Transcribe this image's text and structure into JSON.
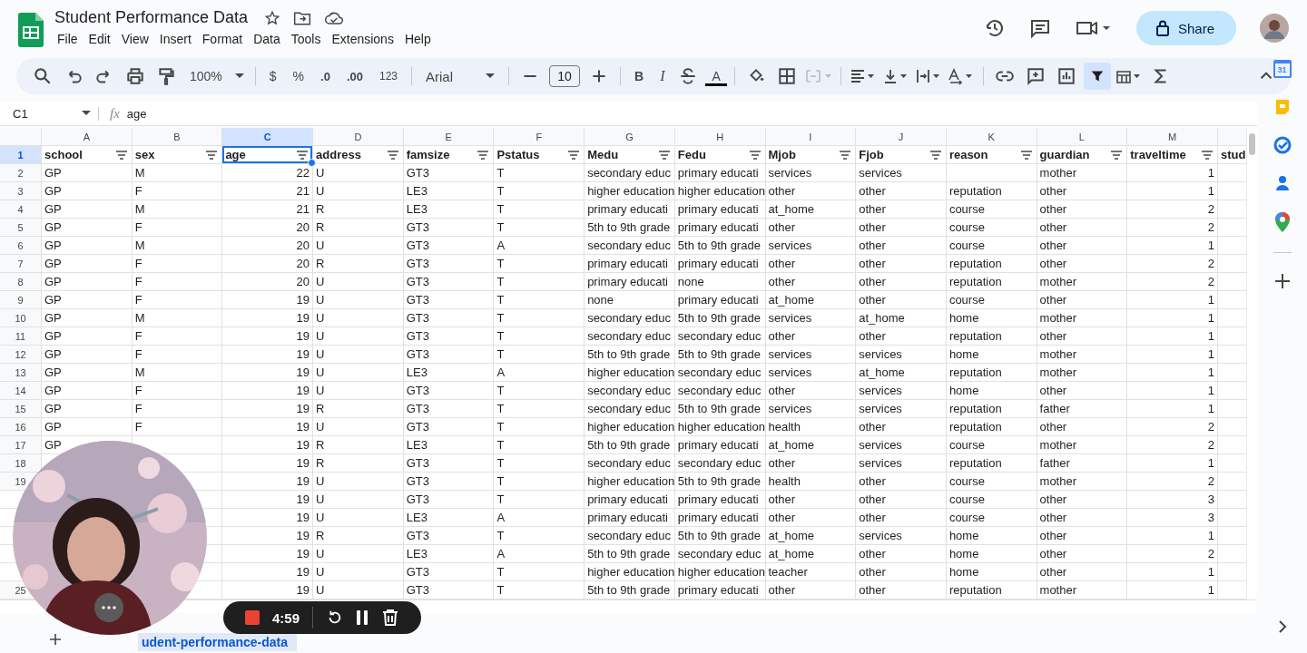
{
  "app": {
    "title": "Student Performance Data",
    "menu": [
      "File",
      "Edit",
      "View",
      "Insert",
      "Format",
      "Data",
      "Tools",
      "Extensions",
      "Help"
    ],
    "share": "Share"
  },
  "toolbar": {
    "zoom": "100%",
    "currency": "$",
    "percent": "%",
    "decrease_decimals": ".0",
    "increase_decimals": ".00",
    "number_format": "123",
    "font": "Arial",
    "font_size": "10",
    "bold": "B",
    "italic": "I",
    "text_color": "A",
    "filter_on": true
  },
  "formula_bar": {
    "cell_ref": "C1",
    "fx": "fx",
    "value": "age"
  },
  "side_panel": {
    "calendar_day": "31"
  },
  "sheet": {
    "columns": [
      {
        "letter": "A",
        "header": "school",
        "numeric": false,
        "selected": false,
        "filter": true
      },
      {
        "letter": "B",
        "header": "sex",
        "numeric": false,
        "selected": false,
        "filter": true
      },
      {
        "letter": "C",
        "header": "age",
        "numeric": true,
        "selected": true,
        "filter": true
      },
      {
        "letter": "D",
        "header": "address",
        "numeric": false,
        "selected": false,
        "filter": true
      },
      {
        "letter": "E",
        "header": "famsize",
        "numeric": false,
        "selected": false,
        "filter": true
      },
      {
        "letter": "F",
        "header": "Pstatus",
        "numeric": false,
        "selected": false,
        "filter": true
      },
      {
        "letter": "G",
        "header": "Medu",
        "numeric": false,
        "selected": false,
        "filter": true
      },
      {
        "letter": "H",
        "header": "Fedu",
        "numeric": false,
        "selected": false,
        "filter": true
      },
      {
        "letter": "I",
        "header": "Mjob",
        "numeric": false,
        "selected": false,
        "filter": true
      },
      {
        "letter": "J",
        "header": "Fjob",
        "numeric": false,
        "selected": false,
        "filter": true
      },
      {
        "letter": "K",
        "header": "reason",
        "numeric": false,
        "selected": false,
        "filter": true
      },
      {
        "letter": "L",
        "header": "guardian",
        "numeric": false,
        "selected": false,
        "filter": true
      },
      {
        "letter": "M",
        "header": "traveltime",
        "numeric": true,
        "selected": false,
        "filter": true
      },
      {
        "header": "stud",
        "selected": false,
        "filter": false
      }
    ],
    "header_row": {
      "number": "1",
      "selected": true
    },
    "rows": [
      {
        "number": "2",
        "selected": false,
        "cells": [
          "GP",
          "M",
          "22",
          "U",
          "GT3",
          "T",
          "secondary educ",
          "primary educati",
          "services",
          "services",
          null,
          "mother",
          "1",
          null
        ]
      },
      {
        "number": "3",
        "selected": false,
        "cells": [
          "GP",
          "F",
          "21",
          "U",
          "LE3",
          "T",
          "higher education",
          "higher education",
          "other",
          "other",
          "reputation",
          "other",
          "1",
          null
        ]
      },
      {
        "number": "4",
        "selected": false,
        "cells": [
          "GP",
          "M",
          "21",
          "R",
          "LE3",
          "T",
          "primary educati",
          "primary educati",
          "at_home",
          "other",
          "course",
          "other",
          "2",
          null
        ]
      },
      {
        "number": "5",
        "selected": false,
        "cells": [
          "GP",
          "F",
          "20",
          "R",
          "GT3",
          "T",
          "5th to 9th grade",
          "primary educati",
          "other",
          "other",
          "course",
          "other",
          "2",
          null
        ]
      },
      {
        "number": "6",
        "selected": false,
        "cells": [
          "GP",
          "M",
          "20",
          "U",
          "GT3",
          "A",
          "secondary educ",
          "5th to 9th grade",
          "services",
          "other",
          "course",
          "other",
          "1",
          null
        ]
      },
      {
        "number": "7",
        "selected": false,
        "cells": [
          "GP",
          "F",
          "20",
          "R",
          "GT3",
          "T",
          "primary educati",
          "primary educati",
          "other",
          "other",
          "reputation",
          "other",
          "2",
          null
        ]
      },
      {
        "number": "8",
        "selected": false,
        "cells": [
          "GP",
          "F",
          "20",
          "U",
          "GT3",
          "T",
          "primary educati",
          "none",
          "other",
          "other",
          "reputation",
          "mother",
          "2",
          null
        ]
      },
      {
        "number": "9",
        "selected": false,
        "cells": [
          "GP",
          "F",
          "19",
          "U",
          "GT3",
          "T",
          "none",
          "primary educati",
          "at_home",
          "other",
          "course",
          "other",
          "1",
          null
        ]
      },
      {
        "number": "10",
        "selected": false,
        "cells": [
          "GP",
          "M",
          "19",
          "U",
          "GT3",
          "T",
          "secondary educ",
          "5th to 9th grade",
          "services",
          "at_home",
          "home",
          "mother",
          "1",
          null
        ]
      },
      {
        "number": "11",
        "selected": false,
        "cells": [
          "GP",
          "F",
          "19",
          "U",
          "GT3",
          "T",
          "secondary educ",
          "secondary educ",
          "other",
          "other",
          "reputation",
          "other",
          "1",
          null
        ]
      },
      {
        "number": "12",
        "selected": false,
        "cells": [
          "GP",
          "F",
          "19",
          "U",
          "GT3",
          "T",
          "5th to 9th grade",
          "5th to 9th grade",
          "services",
          "services",
          "home",
          "mother",
          "1",
          null
        ]
      },
      {
        "number": "13",
        "selected": false,
        "cells": [
          "GP",
          "M",
          "19",
          "U",
          "LE3",
          "A",
          "higher education",
          "secondary educ",
          "services",
          "at_home",
          "reputation",
          "mother",
          "1",
          null
        ]
      },
      {
        "number": "14",
        "selected": false,
        "cells": [
          "GP",
          "F",
          "19",
          "U",
          "GT3",
          "T",
          "secondary educ",
          "secondary educ",
          "other",
          "services",
          "home",
          "other",
          "1",
          null
        ]
      },
      {
        "number": "15",
        "selected": false,
        "cells": [
          "GP",
          "F",
          "19",
          "R",
          "GT3",
          "T",
          "secondary educ",
          "5th to 9th grade",
          "services",
          "services",
          "reputation",
          "father",
          "1",
          null
        ]
      },
      {
        "number": "16",
        "selected": false,
        "cells": [
          "GP",
          "F",
          "19",
          "U",
          "GT3",
          "T",
          "higher education",
          "higher education",
          "health",
          "other",
          "reputation",
          "other",
          "2",
          null
        ]
      },
      {
        "number": "17",
        "selected": false,
        "cells": [
          "GP",
          null,
          "19",
          "R",
          "LE3",
          "T",
          "5th to 9th grade",
          "primary educati",
          "at_home",
          "services",
          "course",
          "mother",
          "2",
          null
        ]
      },
      {
        "number": "18",
        "selected": false,
        "cells": [
          null,
          null,
          "19",
          "R",
          "GT3",
          "T",
          "secondary educ",
          "secondary educ",
          "other",
          "services",
          "reputation",
          "father",
          "1",
          null
        ]
      },
      {
        "number": "19",
        "selected": false,
        "cells": [
          null,
          null,
          "19",
          "U",
          "GT3",
          "T",
          "higher education",
          "5th to 9th grade",
          "health",
          "other",
          "course",
          "mother",
          "2",
          null
        ]
      },
      {
        "cells": [
          null,
          null,
          "19",
          "U",
          "GT3",
          "T",
          "primary educati",
          "primary educati",
          "other",
          "other",
          "course",
          "other",
          "3",
          null
        ]
      },
      {
        "cells": [
          null,
          null,
          "19",
          "U",
          "LE3",
          "A",
          "primary educati",
          "primary educati",
          "other",
          "other",
          "course",
          "other",
          "3",
          null
        ]
      },
      {
        "cells": [
          null,
          null,
          "19",
          "R",
          "GT3",
          "T",
          "secondary educ",
          "5th to 9th grade",
          "at_home",
          "services",
          "home",
          "other",
          "1",
          null
        ]
      },
      {
        "cells": [
          null,
          null,
          "19",
          "U",
          "LE3",
          "A",
          "5th to 9th grade",
          "secondary educ",
          "at_home",
          "other",
          "home",
          "other",
          "2",
          null
        ]
      },
      {
        "cells": [
          null,
          null,
          "19",
          "U",
          "GT3",
          "T",
          "higher education",
          "higher education",
          "teacher",
          "other",
          "home",
          "other",
          "1",
          null
        ]
      },
      {
        "number": "25",
        "selected": false,
        "cells": [
          null,
          null,
          "19",
          "U",
          "GT3",
          "T",
          "5th to 9th grade",
          "primary educati",
          "other",
          "other",
          "reputation",
          "mother",
          "1",
          null
        ]
      }
    ]
  },
  "sheet_tabs": [
    {
      "label": "udent-performance-data",
      "selected": true
    }
  ],
  "recorder": {
    "time": "4:59"
  }
}
